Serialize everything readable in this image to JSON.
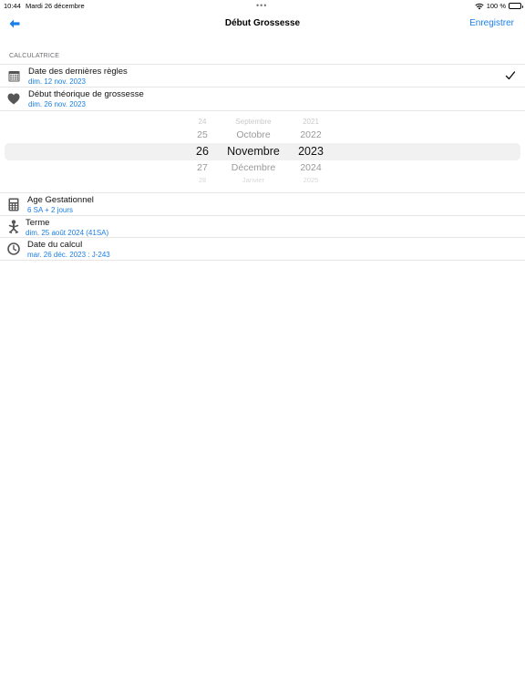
{
  "status_bar": {
    "time": "10:44",
    "date": "Mardi 26 décembre",
    "battery": "100 %"
  },
  "nav": {
    "title": "Début Grossesse",
    "save_label": "Enregistrer"
  },
  "section": {
    "header": "CALCULATRICE"
  },
  "rows": [
    {
      "title": "Date des dernières règles",
      "subtitle": "dim. 12 nov. 2023",
      "icon": "calendar-icon",
      "checked": true
    },
    {
      "title": "Début théorique de grossesse",
      "subtitle": "dim. 26 nov. 2023",
      "icon": "heart-icon"
    }
  ],
  "picker": {
    "days": [
      "24",
      "25",
      "26",
      "27",
      "28"
    ],
    "months": [
      "Septembre",
      "Octobre",
      "Novembre",
      "Décembre",
      "Janvier"
    ],
    "years": [
      "2021",
      "2022",
      "2023",
      "2024",
      "2025"
    ]
  },
  "results": [
    {
      "title": "Age Gestationnel",
      "subtitle": "6  SA  + 2  jours",
      "icon": "calculator-icon"
    },
    {
      "title": "Terme",
      "subtitle": "dim. 25 août 2024 (41SA)",
      "icon": "baby-icon"
    },
    {
      "title": "Date du calcul",
      "subtitle": "mar. 26 déc. 2023 : J-243",
      "icon": "clock-icon"
    }
  ],
  "colors": {
    "accent": "#1a7fe6",
    "icon": "#555555",
    "separator": "#e6e6e6"
  }
}
